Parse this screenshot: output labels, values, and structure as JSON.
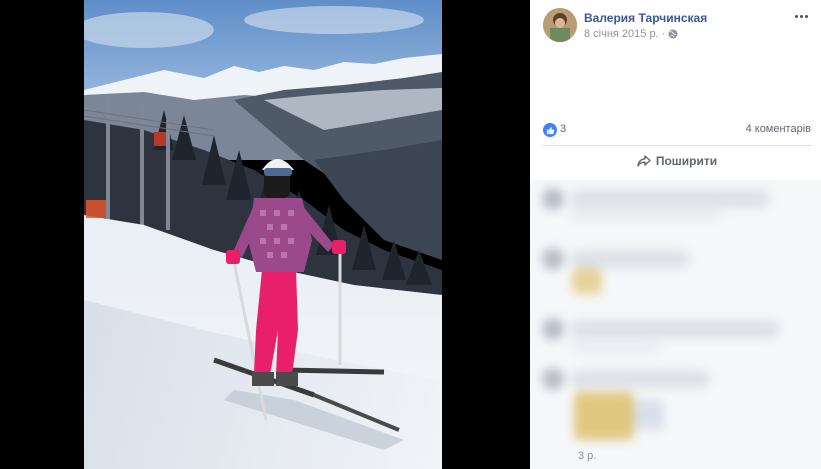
{
  "post": {
    "author": "Валерия Тарчинская",
    "date": "8 січня 2015 р.",
    "privacy_icon": "globe-icon",
    "more_icon": "more-options-icon"
  },
  "reactions": {
    "icon": "like-icon",
    "count": "3",
    "comments": "4 коментарів"
  },
  "actions": {
    "share_label": "Поширити",
    "share_icon": "share-arrow-icon"
  },
  "comments_area": {
    "visible_time": "3 р."
  },
  "colors": {
    "author_link": "#385898",
    "like_blue": "#4080ff",
    "viewer_bg": "#000000",
    "ski_jacket": "#9a4a8a",
    "ski_pants": "#e8206a"
  }
}
